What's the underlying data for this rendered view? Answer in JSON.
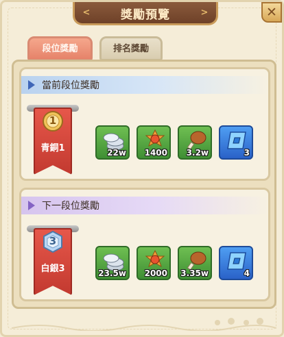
{
  "header": {
    "title": "獎勵預覽"
  },
  "tabs": [
    {
      "label": "段位獎勵",
      "active": true
    },
    {
      "label": "排名獎勵",
      "active": false
    }
  ],
  "current": {
    "heading": "當前段位獎勵",
    "rank": {
      "name": "青銅1",
      "number": "1",
      "tier_color": "#e2b34a"
    },
    "rewards": [
      {
        "icon": "silver-coins-icon",
        "quantity": "22w"
      },
      {
        "icon": "gold-badge-icon",
        "quantity": "1400"
      },
      {
        "icon": "drumstick-icon",
        "quantity": "3.2w"
      },
      {
        "icon": "blue-gem-icon",
        "quantity": "3"
      }
    ]
  },
  "next": {
    "heading": "下一段位獎勵",
    "rank": {
      "name": "白銀3",
      "number": "3",
      "tier_color": "#9cc3ee"
    },
    "rewards": [
      {
        "icon": "silver-coins-icon",
        "quantity": "23.5w"
      },
      {
        "icon": "gold-badge-icon",
        "quantity": "2000"
      },
      {
        "icon": "drumstick-icon",
        "quantity": "3.35w"
      },
      {
        "icon": "blue-gem-icon",
        "quantity": "4"
      }
    ]
  },
  "colors": {
    "accent_tab": "#e6836a",
    "frame": "#ecdfbf",
    "title_bar": "#6e4128"
  }
}
